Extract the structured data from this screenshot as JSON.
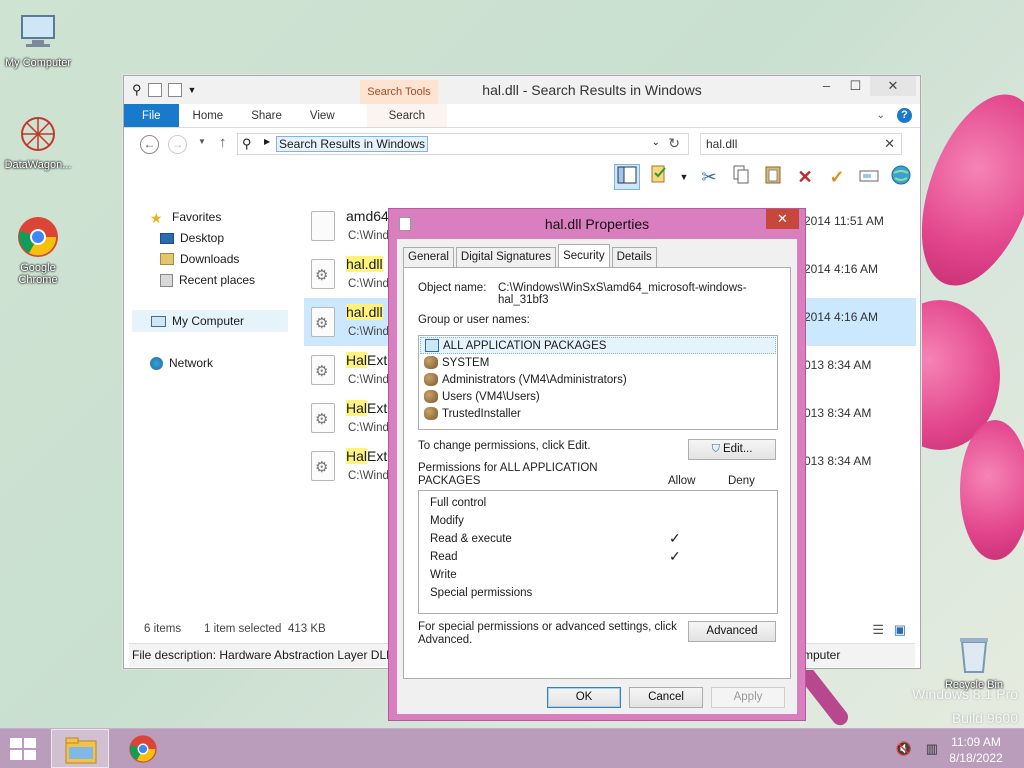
{
  "desktop": {
    "icons": [
      {
        "label": "My Computer",
        "icon": "computer-icon"
      },
      {
        "label": "DataWagon...",
        "icon": "datawagon-icon"
      },
      {
        "label": "Google Chrome",
        "icon": "chrome-icon"
      },
      {
        "label": "Recycle Bin",
        "icon": "recycle-bin-icon"
      }
    ],
    "watermark_line1": "Windows 8.1 Pro",
    "watermark_line2": "Build 9600"
  },
  "explorer": {
    "title": "hal.dll - Search Results in Windows",
    "context_tab_header": "Search Tools",
    "ribbon_tabs": [
      "File",
      "Home",
      "Share",
      "View",
      "Search"
    ],
    "address_crumb": "Search Results in Windows",
    "search_value": "hal.dll",
    "nav": {
      "favorites": "Favorites",
      "desktop": "Desktop",
      "downloads": "Downloads",
      "recent": "Recent places",
      "my_computer": "My Computer",
      "network": "Network"
    },
    "files": [
      {
        "name_hl": "",
        "name_rest": "amd64",
        "path": "C:\\Windo",
        "date": "2014 11:51 AM"
      },
      {
        "name_hl": "hal.dll",
        "name_rest": "",
        "path": "C:\\Windo",
        "date": "2014 4:16 AM"
      },
      {
        "name_hl": "hal.dll",
        "name_rest": "",
        "path": "C:\\Windo",
        "date": "2014 4:16 AM"
      },
      {
        "name_hl": "Hal",
        "name_rest": "Ext",
        "path": "C:\\Windo",
        "date": "013 8:34 AM"
      },
      {
        "name_hl": "Hal",
        "name_rest": "Ext",
        "path": "C:\\Windo",
        "date": "013 8:34 AM"
      },
      {
        "name_hl": "Hal",
        "name_rest": "Ext",
        "path": "C:\\Windo",
        "date": "013 8:34 AM"
      }
    ],
    "status_items": "6 items",
    "status_selected": "1 item selected",
    "status_size": "413 KB",
    "description": "File description: Hardware Abstraction Layer DLL",
    "description_right": "mputer"
  },
  "dialog": {
    "title": "hal.dll Properties",
    "tabs": [
      "General",
      "Digital Signatures",
      "Security",
      "Details"
    ],
    "object_label": "Object name:",
    "object_value": "C:\\Windows\\WinSxS\\amd64_microsoft-windows-hal_31bf3",
    "group_label": "Group or user names:",
    "users": [
      "ALL APPLICATION PACKAGES",
      "SYSTEM",
      "Administrators (VM4\\Administrators)",
      "Users (VM4\\Users)",
      "TrustedInstaller"
    ],
    "change_text": "To change permissions, click Edit.",
    "edit_label": "Edit...",
    "perm_label_line1": "Permissions for ALL APPLICATION",
    "perm_label_line2": "PACKAGES",
    "allow": "Allow",
    "deny": "Deny",
    "permissions": [
      {
        "name": "Full control",
        "allow": false
      },
      {
        "name": "Modify",
        "allow": false
      },
      {
        "name": "Read & execute",
        "allow": true
      },
      {
        "name": "Read",
        "allow": true
      },
      {
        "name": "Write",
        "allow": false
      },
      {
        "name": "Special permissions",
        "allow": false
      }
    ],
    "check_glyph": "✓",
    "advanced_text_line1": "For special permissions or advanced settings, click",
    "advanced_text_line2": "Advanced.",
    "advanced_label": "Advanced",
    "ok_label": "OK",
    "cancel_label": "Cancel",
    "apply_label": "Apply"
  },
  "taskbar": {
    "time": "11:09 AM",
    "date": "8/18/2022"
  }
}
